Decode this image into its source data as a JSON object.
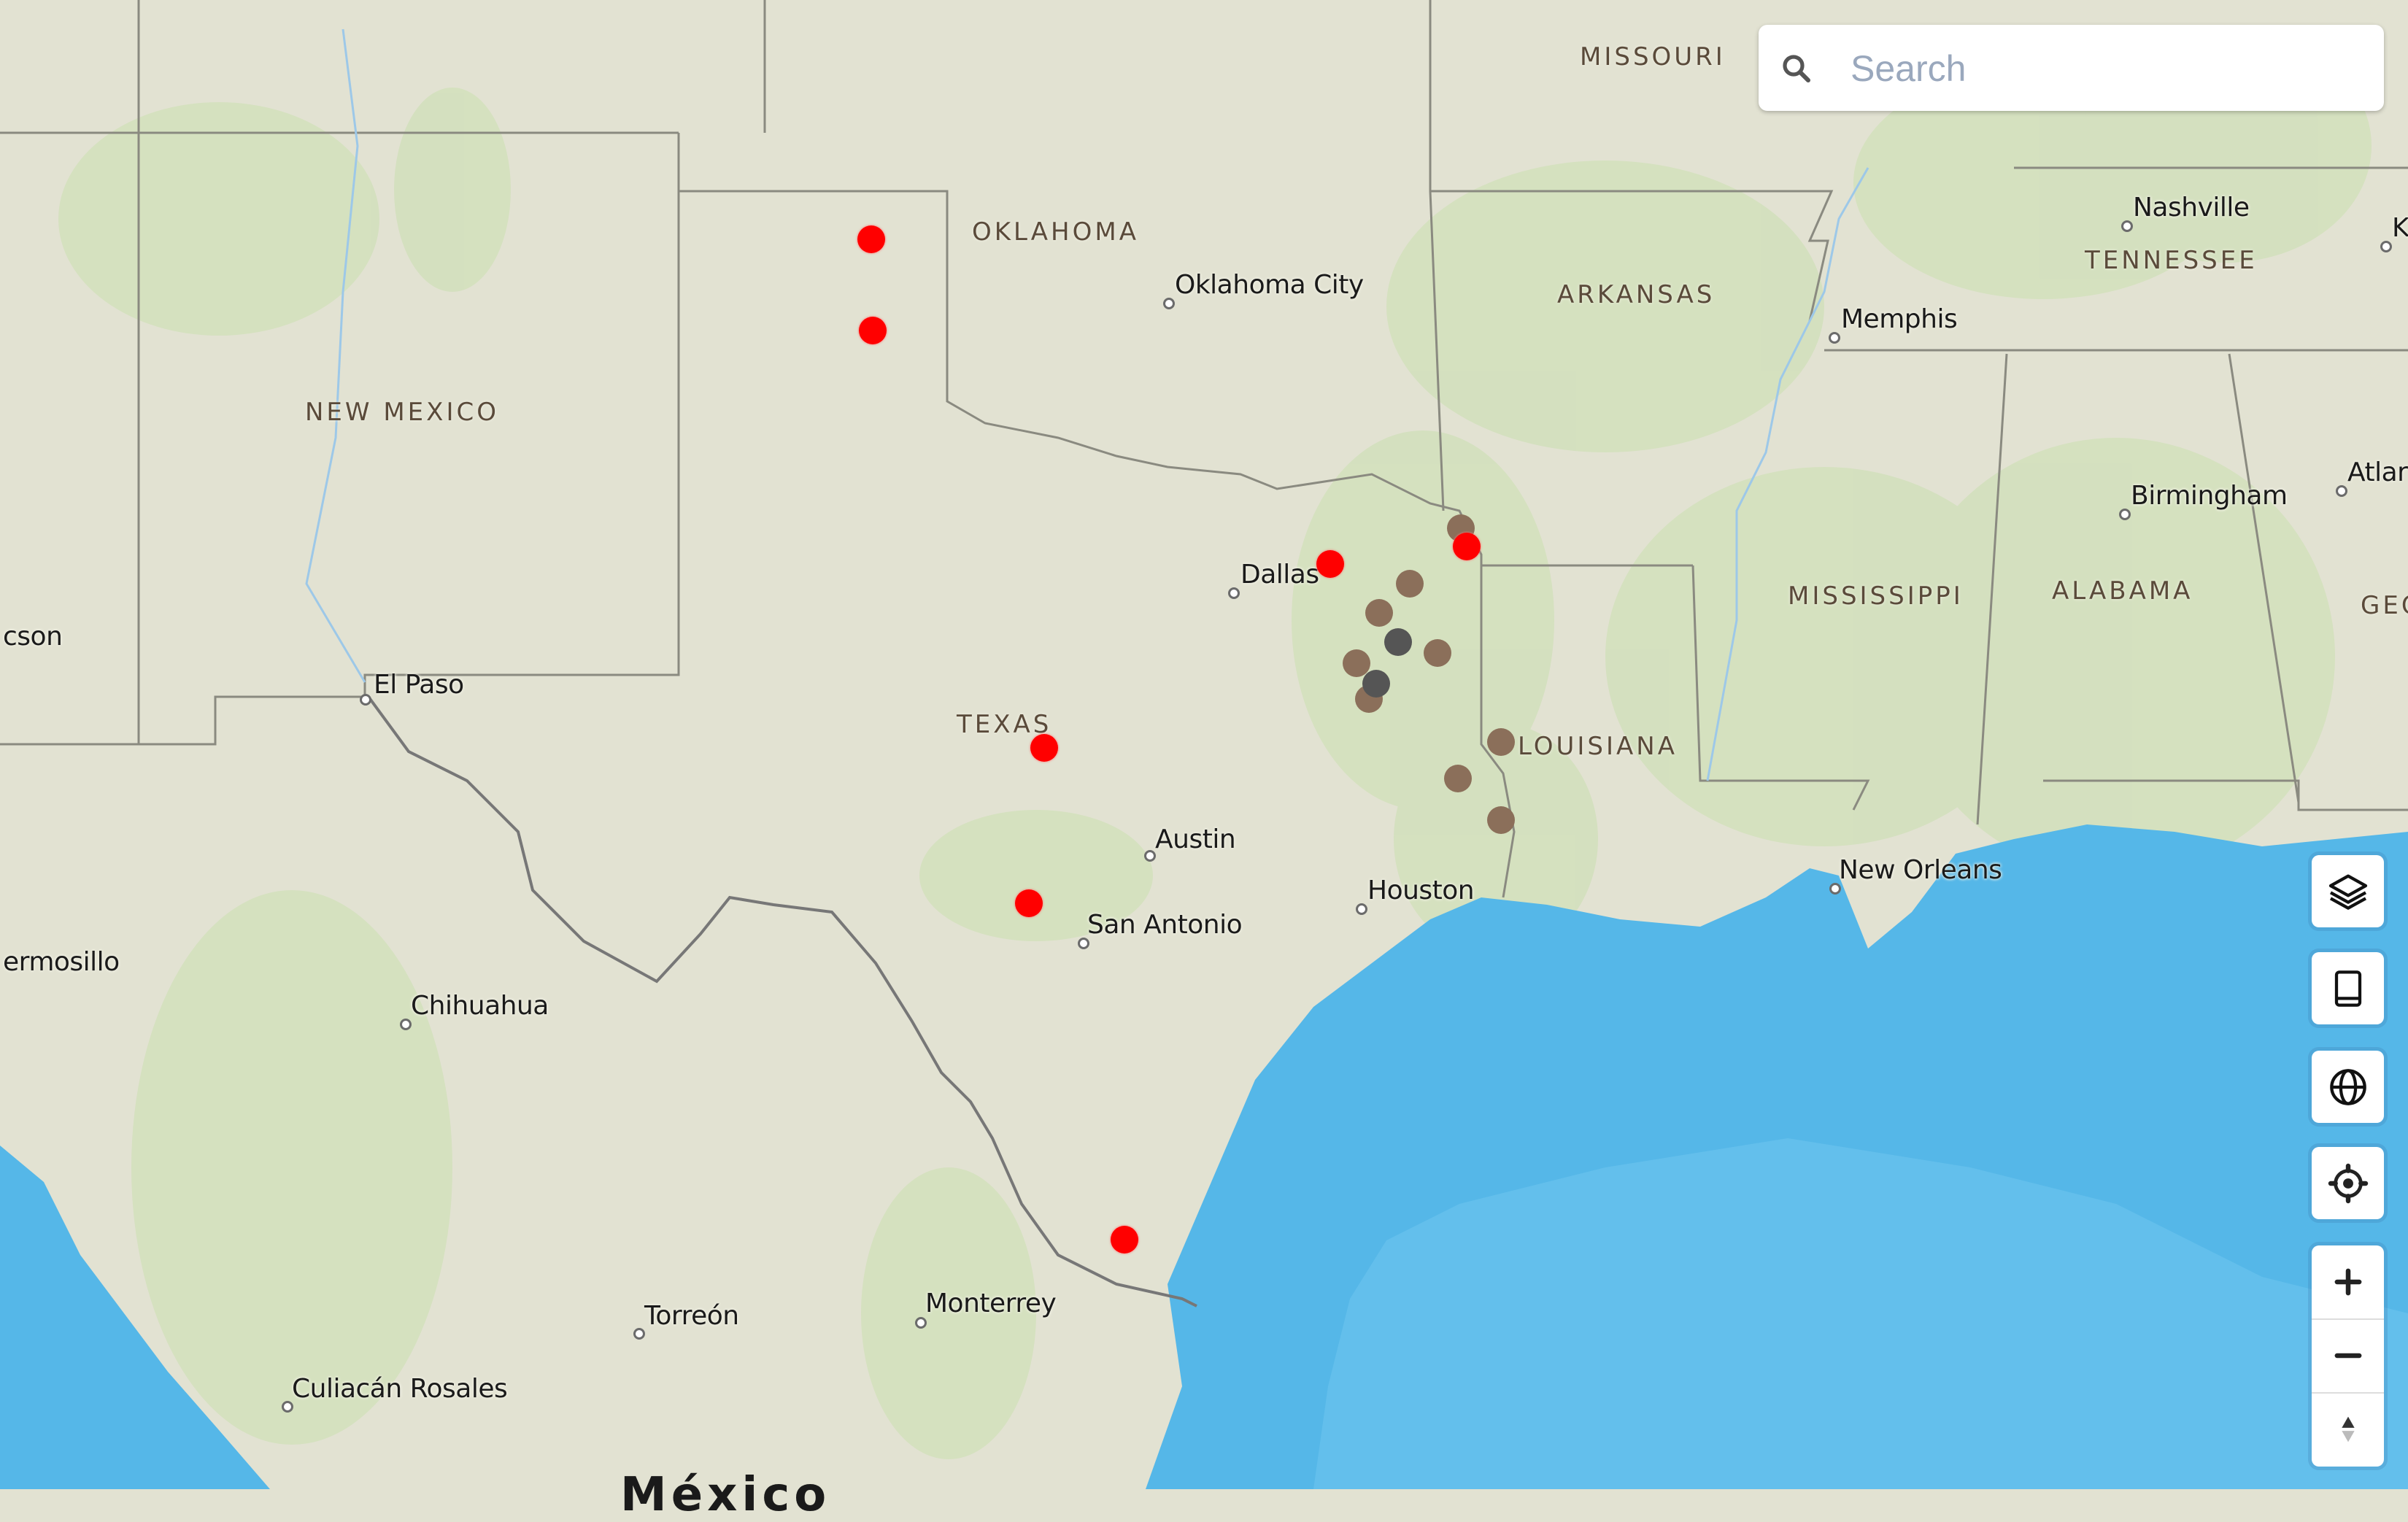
{
  "search": {
    "placeholder": "Search",
    "value": ""
  },
  "controls": {
    "layers": "layers-icon",
    "basemap": "book-icon",
    "globe": "globe-icon",
    "locate": "locate-icon",
    "zoom_in": "+",
    "zoom_out": "−",
    "compass": "compass-icon"
  },
  "states": [
    {
      "name": "MISSOURI"
    },
    {
      "name": "OKLAHOMA"
    },
    {
      "name": "ARKANSAS"
    },
    {
      "name": "TENNESSEE"
    },
    {
      "name": "NEW MEXICO"
    },
    {
      "name": "TEXAS"
    },
    {
      "name": "MISSISSIPPI"
    },
    {
      "name": "ALABAMA"
    },
    {
      "name": "LOUISIANA"
    },
    {
      "name": "GEO"
    }
  ],
  "cities": [
    {
      "name": "Oklahoma City"
    },
    {
      "name": "Nashville"
    },
    {
      "name": "Memphis"
    },
    {
      "name": "Birmingham"
    },
    {
      "name": "Atlar"
    },
    {
      "name": "Dallas"
    },
    {
      "name": "cson"
    },
    {
      "name": "El Paso"
    },
    {
      "name": "Austin"
    },
    {
      "name": "Houston"
    },
    {
      "name": "San Antonio"
    },
    {
      "name": "New Orleans"
    },
    {
      "name": "ermosillo"
    },
    {
      "name": "Chihuahua"
    },
    {
      "name": "Torreón"
    },
    {
      "name": "Monterrey"
    },
    {
      "name": "Culiacán Rosales"
    },
    {
      "name": "K"
    }
  ],
  "country_label": "México",
  "marker_colors": {
    "red": "#ff0000",
    "brown": "#8b6f5a",
    "dark": "#555555"
  },
  "markers": [
    {
      "type": "red"
    },
    {
      "type": "red"
    },
    {
      "type": "red"
    },
    {
      "type": "brown"
    },
    {
      "type": "red"
    },
    {
      "type": "brown"
    },
    {
      "type": "brown"
    },
    {
      "type": "dark"
    },
    {
      "type": "brown"
    },
    {
      "type": "brown"
    },
    {
      "type": "brown"
    },
    {
      "type": "dark"
    },
    {
      "type": "brown"
    },
    {
      "type": "brown"
    },
    {
      "type": "brown"
    },
    {
      "type": "red"
    },
    {
      "type": "red"
    },
    {
      "type": "red"
    }
  ]
}
